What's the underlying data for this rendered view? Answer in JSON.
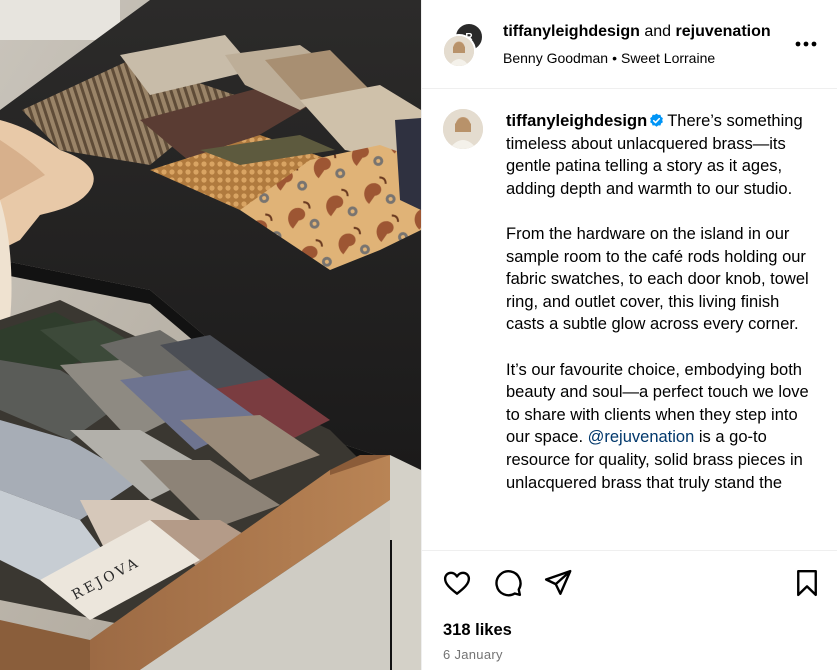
{
  "header": {
    "author": "tiffanyleighdesign",
    "connector": "and",
    "collaborator": "rejuvenation",
    "collab_avatar_letter": "R",
    "artist": "Benny Goodman",
    "separator": "•",
    "song": "Sweet Lorraine"
  },
  "caption": {
    "username": "tiffanyleighdesign",
    "verified": true,
    "paragraph1": "There’s something timeless about unlacquered brass—its gentle patina telling a story as it ages, adding depth and warmth to our studio.",
    "paragraph2": "From the hardware on the island in our sample room to the café rods holding our fabric swatches, to each door knob, towel ring, and outlet cover, this living finish casts a subtle glow across every corner.",
    "paragraph3_before": "It’s our favourite choice, embodying both beauty and soul—a perfect touch we love to share with clients when they step into our space.",
    "mention": "@rejuvenation",
    "paragraph3_after": "is a go-to resource for quality, solid brass pieces in unlacquered brass that truly stand the"
  },
  "actions": {
    "icons": [
      "heart-icon",
      "comment-icon",
      "share-icon",
      "bookmark-icon"
    ]
  },
  "likes": "318 likes",
  "date": "6 January",
  "media": {
    "book_text": "REJOVA"
  },
  "colors": {
    "link": "#00376b",
    "verified": "#0095f6",
    "muted": "#737373"
  }
}
